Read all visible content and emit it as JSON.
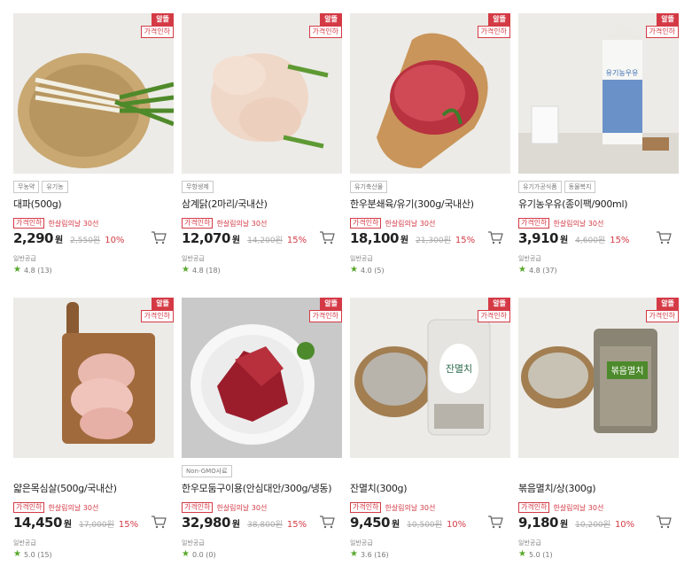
{
  "products": [
    {
      "name": "대파(500g)",
      "tags": [
        "무농약",
        "유기농"
      ],
      "badge_top": "알뜰",
      "badge_sub": "가격인하",
      "promo_badge": "가격인하",
      "promo_text": "한살림의날 30선",
      "price": "2,290",
      "won": "원",
      "original": "2,550원",
      "discount": "10%",
      "shipping": "일반공급",
      "rating": "4.8 (13)",
      "image": "green-onion"
    },
    {
      "name": "삼계닭(2마리/국내산)",
      "tags": [
        "무항생제"
      ],
      "badge_top": "알뜰",
      "badge_sub": "가격인하",
      "promo_badge": "가격인하",
      "promo_text": "한살림의날 30선",
      "price": "12,070",
      "won": "원",
      "original": "14,200원",
      "discount": "15%",
      "shipping": "일반공급",
      "rating": "4.8 (18)",
      "image": "chicken"
    },
    {
      "name": "한우분쇄육/유기(300g/국내산)",
      "tags": [
        "유기축산물"
      ],
      "badge_top": "알뜰",
      "badge_sub": "가격인하",
      "promo_badge": "가격인하",
      "promo_text": "한살림의날 30선",
      "price": "18,100",
      "won": "원",
      "original": "21,300원",
      "discount": "15%",
      "shipping": "일반공급",
      "rating": "4.0 (5)",
      "image": "ground-beef"
    },
    {
      "name": "유기농우유(종이팩/900ml)",
      "tags": [
        "유기가공식품",
        "동물복지"
      ],
      "badge_top": "알뜰",
      "badge_sub": "가격인하",
      "promo_badge": "가격인하",
      "promo_text": "한살림의날 30선",
      "price": "3,910",
      "won": "원",
      "original": "4,600원",
      "discount": "15%",
      "shipping": "일반공급",
      "rating": "4.8 (37)",
      "image": "milk",
      "milk_label": "유기농우유"
    },
    {
      "name": "얇은목심살(500g/국내산)",
      "tags": [],
      "badge_top": "알뜰",
      "badge_sub": "가격인하",
      "promo_badge": "가격인하",
      "promo_text": "한살림의날 30선",
      "price": "14,450",
      "won": "원",
      "original": "17,000원",
      "discount": "15%",
      "shipping": "일반공급",
      "rating": "5.0 (15)",
      "image": "pork"
    },
    {
      "name": "한우모둠구이용(안심대안/300g/냉동)",
      "tags": [
        "Non-GMO사료"
      ],
      "badge_top": "알뜰",
      "badge_sub": "가격인하",
      "promo_badge": "가격인하",
      "promo_text": "한살림의날 30선",
      "price": "32,980",
      "won": "원",
      "original": "38,800원",
      "discount": "15%",
      "shipping": "일반공급",
      "rating": "0.0 (0)",
      "image": "beef"
    },
    {
      "name": "잔멸치(300g)",
      "tags": [],
      "badge_top": "알뜰",
      "badge_sub": "가격인하",
      "promo_badge": "가격인하",
      "promo_text": "한살림의날 30선",
      "price": "9,450",
      "won": "원",
      "original": "10,500원",
      "discount": "10%",
      "shipping": "일반공급",
      "rating": "3.6 (16)",
      "image": "anchovy-small",
      "pack_label": "잔멸치"
    },
    {
      "name": "볶음멸치/상(300g)",
      "tags": [],
      "badge_top": "알뜰",
      "badge_sub": "가격인하",
      "promo_badge": "가격인하",
      "promo_text": "한살림의날 30선",
      "price": "9,180",
      "won": "원",
      "original": "10,200원",
      "discount": "10%",
      "shipping": "일반공급",
      "rating": "5.0 (1)",
      "image": "anchovy-fried",
      "pack_label": "볶음멸치"
    }
  ],
  "colors": {
    "accent": "#d43a45",
    "star": "#58a82c"
  }
}
